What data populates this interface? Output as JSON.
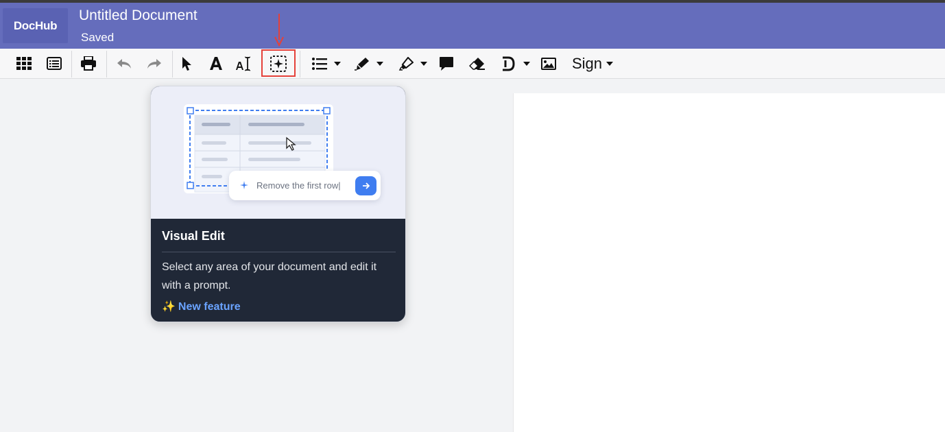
{
  "app": {
    "logo": "DocHub",
    "title": "Untitled Document",
    "status": "Saved"
  },
  "toolbar": {
    "items": [
      {
        "name": "apps-grid-button",
        "icon": "grid-icon"
      },
      {
        "name": "page-list-button",
        "icon": "list-icon"
      },
      {
        "name": "print-button",
        "icon": "printer-icon"
      },
      {
        "name": "undo-button",
        "icon": "undo-icon"
      },
      {
        "name": "redo-button",
        "icon": "redo-icon"
      },
      {
        "name": "select-tool-button",
        "icon": "cursor-icon"
      },
      {
        "name": "text-tool-button",
        "icon": "text-icon"
      },
      {
        "name": "text-cursor-tool-button",
        "icon": "text-cursor-icon"
      },
      {
        "name": "visual-edit-button",
        "icon": "sparkle-select-icon"
      },
      {
        "name": "list-tool-button",
        "icon": "bullet-list-icon"
      },
      {
        "name": "pen-tool-button",
        "icon": "pen-icon"
      },
      {
        "name": "highlighter-tool-button",
        "icon": "highlighter-icon"
      },
      {
        "name": "comment-tool-button",
        "icon": "comment-icon"
      },
      {
        "name": "eraser-tool-button",
        "icon": "eraser-icon"
      },
      {
        "name": "redact-tool-button",
        "icon": "redact-icon"
      },
      {
        "name": "image-tool-button",
        "icon": "image-icon"
      }
    ],
    "sign_label": "Sign"
  },
  "tooltip": {
    "title": "Visual Edit",
    "description": "Select any area of your document and edit it with a prompt.",
    "badge": "New feature",
    "badge_icon": "✨",
    "prompt_placeholder": "Remove the first row|"
  },
  "colors": {
    "header": "#656dbc",
    "accent": "#3f7df0",
    "highlight": "#e5413a",
    "card": "#202837"
  }
}
